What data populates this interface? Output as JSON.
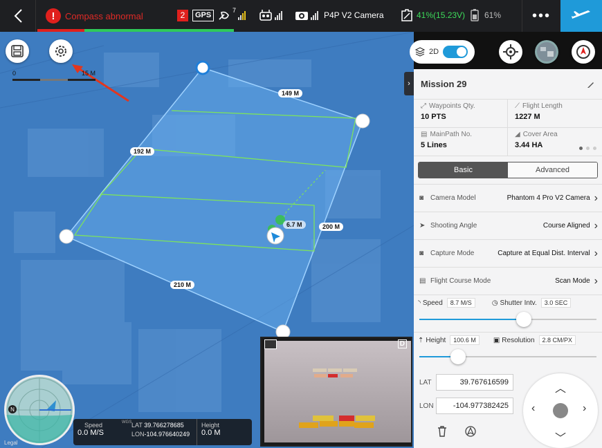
{
  "topbar": {
    "alert": "Compass abnormal",
    "sat_count": "2",
    "gps_label": "GPS",
    "rc_signal_count": "7",
    "camera_name": "P4P V2 Camera",
    "battery_text": "41%(15.23V)",
    "rc_battery": "61%",
    "more": "•••"
  },
  "map": {
    "scale_start": "0",
    "scale_end": "15 M",
    "distance_labels": [
      "149 M",
      "192 M",
      "200 M",
      "210 M"
    ],
    "home_altitude": "6.7 M",
    "mode_label": "2D"
  },
  "telemetry": {
    "speed_label": "Speed",
    "speed_value": "0.0 M/S",
    "gps_sys": "WGS",
    "lat_label": "LAT",
    "lat_value": "39.766278685",
    "lon_label": "LON",
    "lon_value": "-104.976640249",
    "height_label": "Height",
    "height_value": "0.0 M",
    "legal": "Legal"
  },
  "panel": {
    "mission_title": "Mission 29",
    "stats": [
      {
        "label": "Waypoints Qty.",
        "value": "10 PTS"
      },
      {
        "label": "Flight Length",
        "value": "1227 M"
      },
      {
        "label": "MainPath No.",
        "value": "5 Lines"
      },
      {
        "label": "Cover Area",
        "value": "3.44 HA"
      }
    ],
    "tab_basic": "Basic",
    "tab_advanced": "Advanced",
    "settings": [
      {
        "name": "Camera Model",
        "value": "Phantom 4 Pro V2 Camera"
      },
      {
        "name": "Shooting Angle",
        "value": "Course Aligned"
      },
      {
        "name": "Capture Mode",
        "value": "Capture at Equal Dist. Interval"
      },
      {
        "name": "Flight Course Mode",
        "value": "Scan Mode"
      }
    ],
    "speed_label": "Speed",
    "speed_value": "8.7 M/S",
    "speed_fraction": 0.59,
    "shutter_label": "Shutter Intv.",
    "shutter_value": "3.0 SEC",
    "height_label": "Height",
    "height_value": "100.6 M",
    "height_fraction": 0.22,
    "resolution_label": "Resolution",
    "resolution_value": "2.8 CM/PX",
    "lat_label": "LAT",
    "lat_value": "39.767616599",
    "lon_label": "LON",
    "lon_value": "-104.977382425"
  },
  "colors": {
    "accent": "#1f9ad9",
    "alert": "#e0201d",
    "battery": "#3ddc5b",
    "survey_area": "#5aa9f0",
    "scan_line": "#7de35c"
  }
}
